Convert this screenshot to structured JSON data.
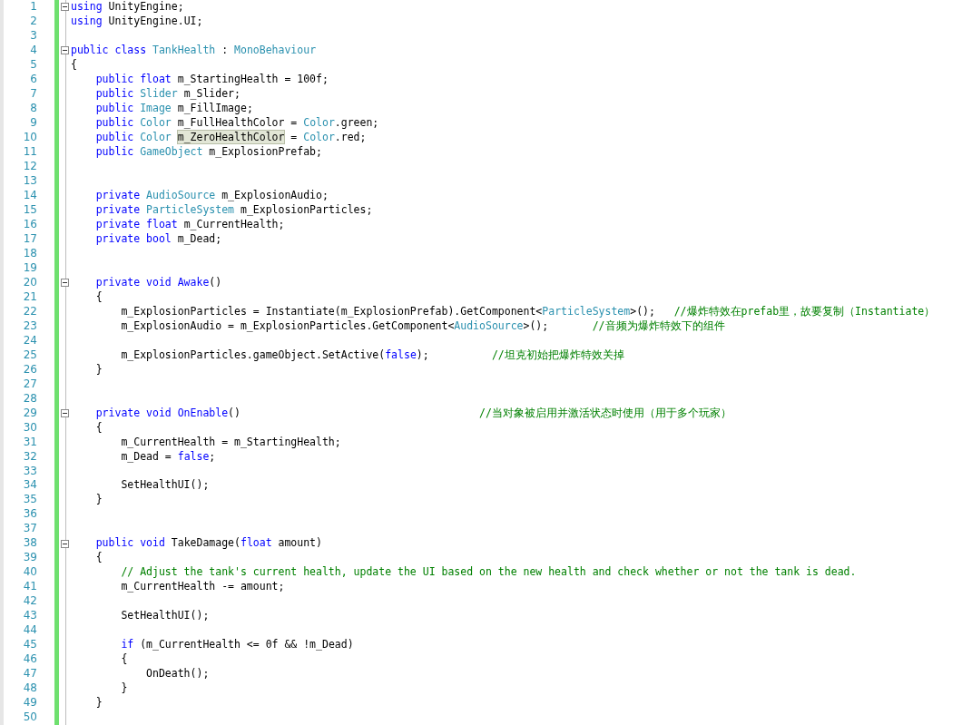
{
  "editor": {
    "lines": [
      {
        "number": "1",
        "fold": true,
        "tokens": [
          {
            "kind": "keyword",
            "text": "using"
          },
          {
            "kind": "plain",
            "text": " UnityEngine;"
          }
        ]
      },
      {
        "number": "2",
        "fold": false,
        "tokens": [
          {
            "kind": "keyword",
            "text": "using"
          },
          {
            "kind": "plain",
            "text": " UnityEngine.UI;"
          }
        ]
      },
      {
        "number": "3",
        "fold": false
      },
      {
        "number": "4",
        "fold": true,
        "tokens": [
          {
            "kind": "keyword",
            "text": "public class "
          },
          {
            "kind": "type",
            "text": "TankHealth"
          },
          {
            "kind": "plain",
            "text": " : "
          },
          {
            "kind": "type",
            "text": "MonoBehaviour"
          }
        ]
      },
      {
        "number": "5",
        "fold": false,
        "tokens": [
          {
            "kind": "plain",
            "text": "{"
          }
        ]
      },
      {
        "number": "6",
        "fold": false,
        "tokens": [
          {
            "kind": "keyword",
            "text": "    public float"
          },
          {
            "kind": "plain",
            "text": " m_StartingHealth = 100f;"
          }
        ]
      },
      {
        "number": "7",
        "fold": false,
        "tokens": [
          {
            "kind": "keyword",
            "text": "    public "
          },
          {
            "kind": "type",
            "text": "Slider"
          },
          {
            "kind": "plain",
            "text": " m_Slider;"
          }
        ]
      },
      {
        "number": "8",
        "fold": false,
        "tokens": [
          {
            "kind": "keyword",
            "text": "    public "
          },
          {
            "kind": "type",
            "text": "Image"
          },
          {
            "kind": "plain",
            "text": " m_FillImage;"
          }
        ]
      },
      {
        "number": "9",
        "fold": false,
        "tokens": [
          {
            "kind": "keyword",
            "text": "    public "
          },
          {
            "kind": "type",
            "text": "Color"
          },
          {
            "kind": "plain",
            "text": " m_FullHealthColor = "
          },
          {
            "kind": "type",
            "text": "Color"
          },
          {
            "kind": "plain",
            "text": ".green;"
          }
        ]
      },
      {
        "number": "10",
        "fold": false,
        "tokens": [
          {
            "kind": "keyword",
            "text": "    public "
          },
          {
            "kind": "type",
            "text": "Color"
          },
          {
            "kind": "highlighted",
            "text": " m_ZeroHealthColor"
          },
          {
            "kind": "plain",
            "text": " = "
          },
          {
            "kind": "type",
            "text": "Color"
          },
          {
            "kind": "plain",
            "text": ".red;"
          }
        ]
      },
      {
        "number": "11",
        "fold": false,
        "tokens": [
          {
            "kind": "keyword",
            "text": "    public "
          },
          {
            "kind": "type",
            "text": "GameObject"
          },
          {
            "kind": "plain",
            "text": " m_ExplosionPrefab;"
          }
        ]
      },
      {
        "number": "12",
        "fold": false
      },
      {
        "number": "13",
        "fold": false
      },
      {
        "number": "14",
        "fold": false,
        "tokens": [
          {
            "kind": "keyword",
            "text": "    private "
          },
          {
            "kind": "type",
            "text": "AudioSource"
          },
          {
            "kind": "plain",
            "text": " m_ExplosionAudio;"
          }
        ]
      },
      {
        "number": "15",
        "fold": false,
        "tokens": [
          {
            "kind": "keyword",
            "text": "    private "
          },
          {
            "kind": "type",
            "text": "ParticleSystem"
          },
          {
            "kind": "plain",
            "text": " m_ExplosionParticles;"
          }
        ]
      },
      {
        "number": "16",
        "fold": false,
        "tokens": [
          {
            "kind": "keyword",
            "text": "    private float"
          },
          {
            "kind": "plain",
            "text": " m_CurrentHealth;"
          }
        ]
      },
      {
        "number": "17",
        "fold": false,
        "tokens": [
          {
            "kind": "keyword",
            "text": "    private bool"
          },
          {
            "kind": "plain",
            "text": " m_Dead;"
          }
        ]
      },
      {
        "number": "18",
        "fold": false
      },
      {
        "number": "19",
        "fold": false
      },
      {
        "number": "20",
        "fold": true,
        "tokens": [
          {
            "kind": "keyword",
            "text": "    private void Awake"
          },
          {
            "kind": "plain",
            "text": "()"
          }
        ]
      },
      {
        "number": "21",
        "fold": false,
        "tokens": [
          {
            "kind": "plain",
            "text": "    {"
          }
        ]
      },
      {
        "number": "22",
        "fold": false,
        "tokens": [
          {
            "kind": "plain",
            "text": "        m_ExplosionParticles = Instantiate(m_ExplosionPrefab).GetComponent<"
          },
          {
            "kind": "type",
            "text": "ParticleSystem"
          },
          {
            "kind": "plain",
            "text": ">();   "
          },
          {
            "kind": "comment",
            "text": "//爆炸特效在prefab里，故要复制（Instantiate）"
          }
        ]
      },
      {
        "number": "23",
        "fold": false,
        "tokens": [
          {
            "kind": "plain",
            "text": "        m_ExplosionAudio = m_ExplosionParticles.GetComponent<"
          },
          {
            "kind": "type",
            "text": "AudioSource"
          },
          {
            "kind": "plain",
            "text": ">();       "
          },
          {
            "kind": "comment",
            "text": "//音频为爆炸特效下的组件"
          }
        ]
      },
      {
        "number": "24",
        "fold": false
      },
      {
        "number": "25",
        "fold": false,
        "tokens": [
          {
            "kind": "plain",
            "text": "        m_ExplosionParticles.gameObject.SetActive("
          },
          {
            "kind": "keyword",
            "text": "false"
          },
          {
            "kind": "plain",
            "text": ");          "
          },
          {
            "kind": "comment",
            "text": "//坦克初始把爆炸特效关掉"
          }
        ]
      },
      {
        "number": "26",
        "fold": false,
        "tokens": [
          {
            "kind": "plain",
            "text": "    }"
          }
        ]
      },
      {
        "number": "27",
        "fold": false
      },
      {
        "number": "28",
        "fold": false
      },
      {
        "number": "29",
        "fold": true,
        "tokens": [
          {
            "kind": "keyword",
            "text": "    private void OnEnable"
          },
          {
            "kind": "plain",
            "text": "()                                      "
          },
          {
            "kind": "comment",
            "text": "//当对象被启用并激活状态时使用（用于多个玩家）"
          }
        ]
      },
      {
        "number": "30",
        "fold": false,
        "tokens": [
          {
            "kind": "plain",
            "text": "    {"
          }
        ]
      },
      {
        "number": "31",
        "fold": false,
        "tokens": [
          {
            "kind": "plain",
            "text": "        m_CurrentHealth = m_StartingHealth;"
          }
        ]
      },
      {
        "number": "32",
        "fold": false,
        "tokens": [
          {
            "kind": "plain",
            "text": "        m_Dead = "
          },
          {
            "kind": "keyword",
            "text": "false"
          },
          {
            "kind": "plain",
            "text": ";"
          }
        ]
      },
      {
        "number": "33",
        "fold": false
      },
      {
        "number": "34",
        "fold": false,
        "tokens": [
          {
            "kind": "plain",
            "text": "        SetHealthUI();"
          }
        ]
      },
      {
        "number": "35",
        "fold": false,
        "tokens": [
          {
            "kind": "plain",
            "text": "    }"
          }
        ]
      },
      {
        "number": "36",
        "fold": false
      },
      {
        "number": "37",
        "fold": false
      },
      {
        "number": "38",
        "fold": true,
        "tokens": [
          {
            "kind": "keyword",
            "text": "    public void"
          },
          {
            "kind": "plain",
            "text": " TakeDamage("
          },
          {
            "kind": "keyword",
            "text": "float"
          },
          {
            "kind": "plain",
            "text": " amount)"
          }
        ]
      },
      {
        "number": "39",
        "fold": false,
        "tokens": [
          {
            "kind": "plain",
            "text": "    {"
          }
        ]
      },
      {
        "number": "40",
        "fold": false,
        "tokens": [
          {
            "kind": "comment",
            "text": "        // Adjust the tank's current health, update the UI based on the new health and check whether or not the tank is dead."
          }
        ]
      },
      {
        "number": "41",
        "fold": false,
        "tokens": [
          {
            "kind": "plain",
            "text": "        m_CurrentHealth -= amount;"
          }
        ]
      },
      {
        "number": "42",
        "fold": false
      },
      {
        "number": "43",
        "fold": false,
        "tokens": [
          {
            "kind": "plain",
            "text": "        SetHealthUI();"
          }
        ]
      },
      {
        "number": "44",
        "fold": false
      },
      {
        "number": "45",
        "fold": false,
        "tokens": [
          {
            "kind": "keyword",
            "text": "        if"
          },
          {
            "kind": "plain",
            "text": " (m_CurrentHealth <= 0f && !m_Dead)"
          }
        ]
      },
      {
        "number": "46",
        "fold": false,
        "tokens": [
          {
            "kind": "plain",
            "text": "        {"
          }
        ]
      },
      {
        "number": "47",
        "fold": false,
        "tokens": [
          {
            "kind": "plain",
            "text": "            OnDeath();"
          }
        ]
      },
      {
        "number": "48",
        "fold": false,
        "tokens": [
          {
            "kind": "plain",
            "text": "        }"
          }
        ]
      },
      {
        "number": "49",
        "fold": false,
        "tokens": [
          {
            "kind": "plain",
            "text": "    }"
          }
        ]
      },
      {
        "number": "50",
        "fold": false
      }
    ]
  }
}
